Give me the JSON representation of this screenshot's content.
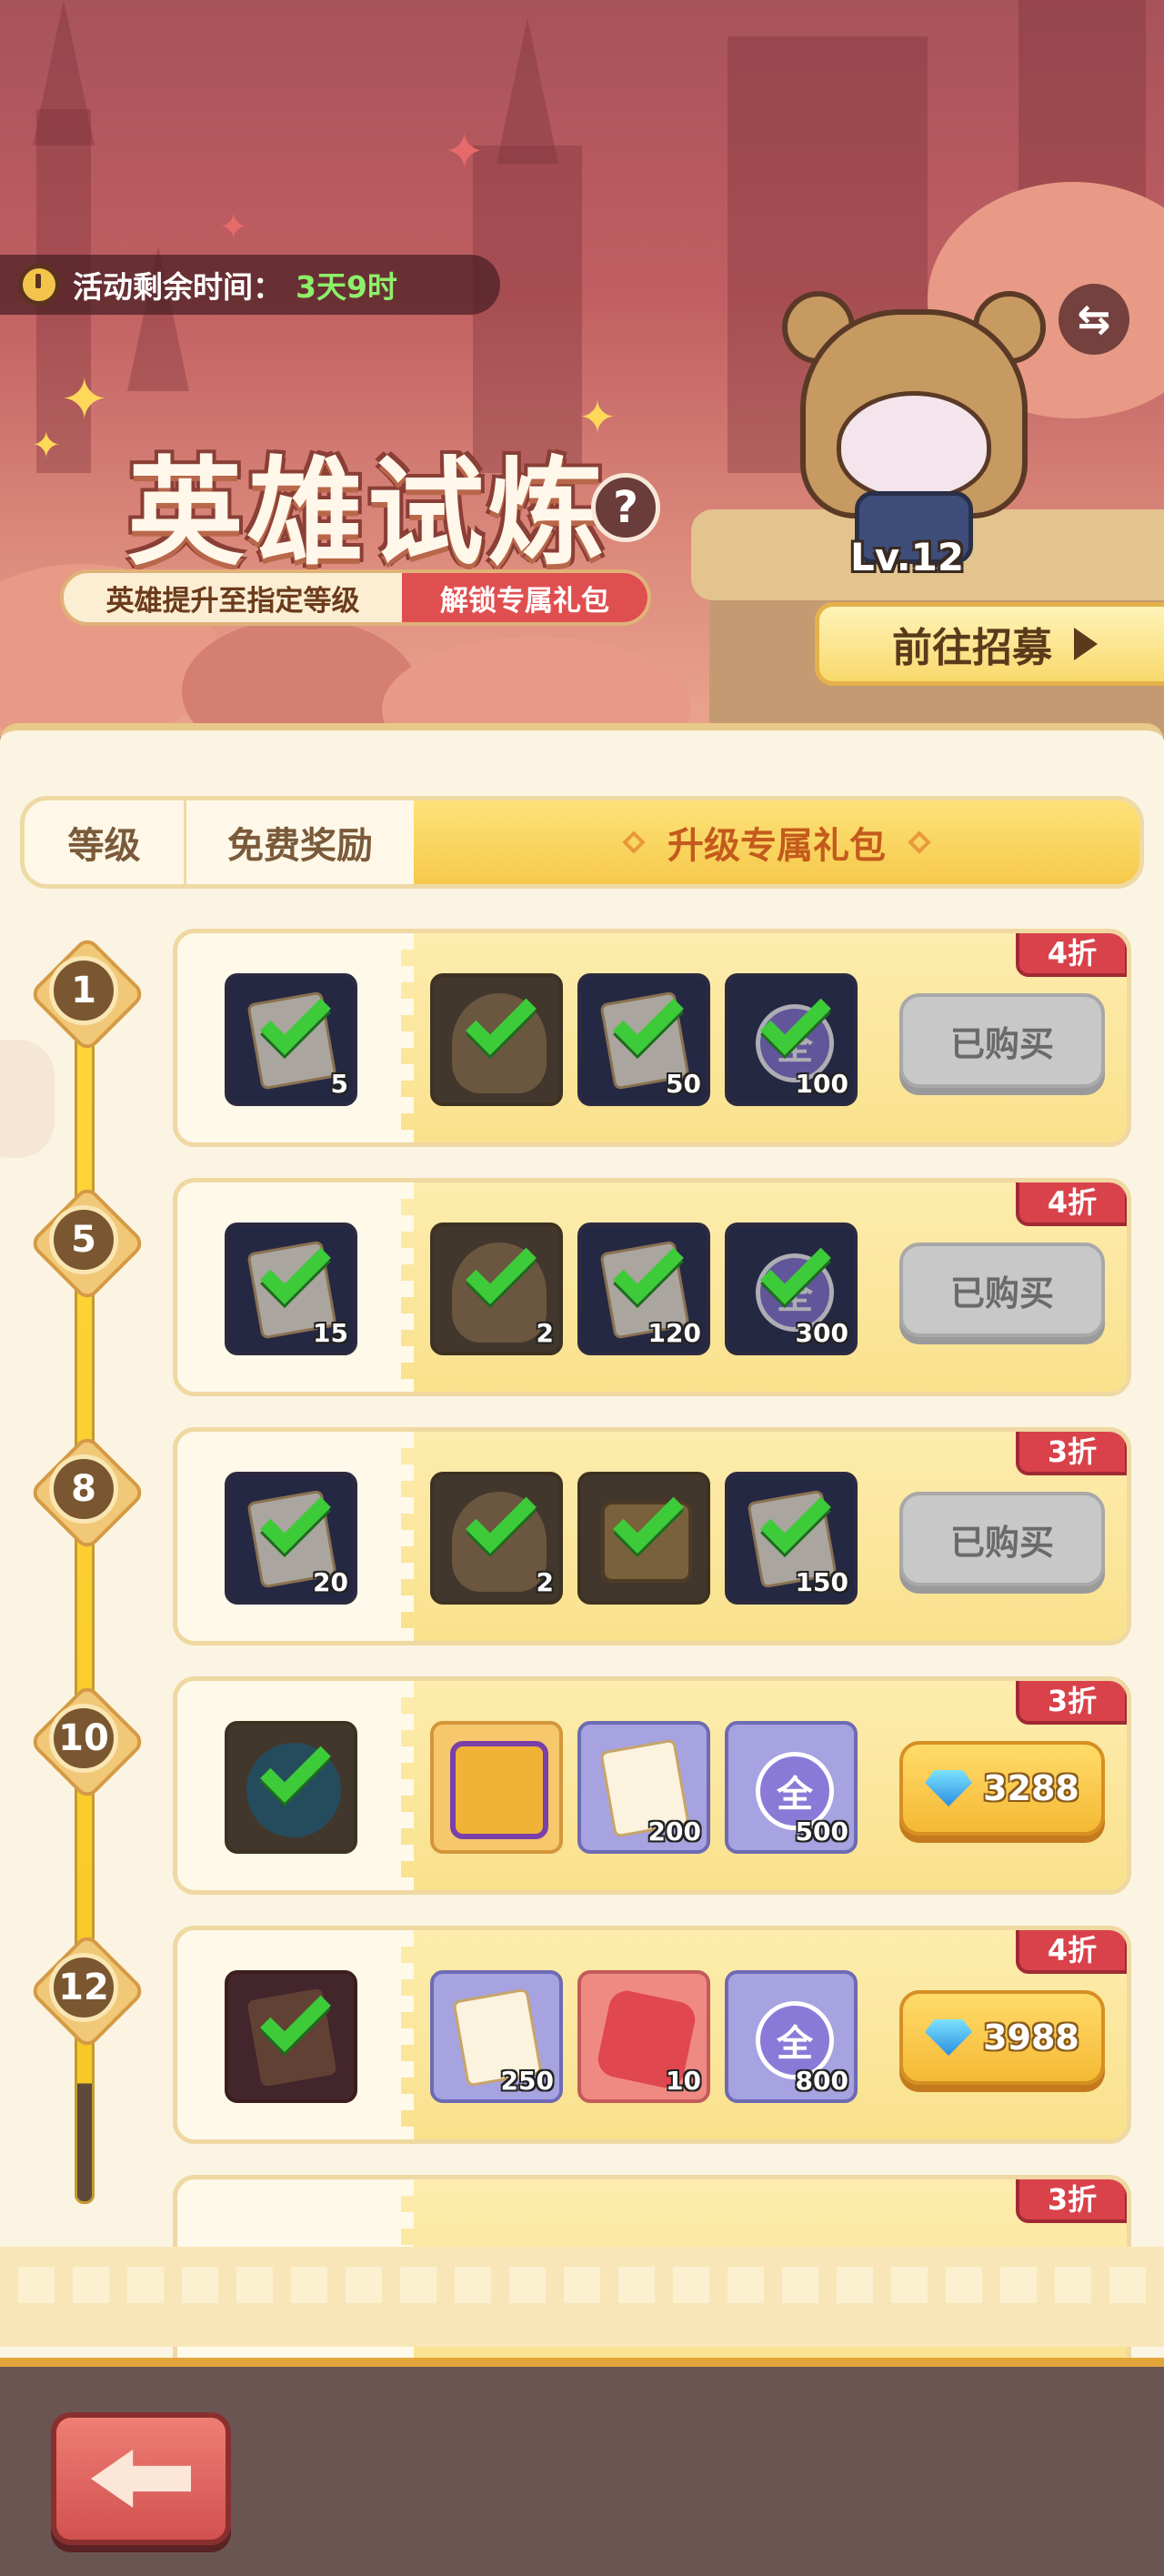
{
  "header": {
    "timer_label": "活动剩余时间：",
    "timer_value": "3天9时",
    "title": "英雄试炼",
    "subtitle_left": "英雄提升至指定等级",
    "subtitle_right": "解锁专属礼包",
    "hero_level": "Lv.12",
    "recruit_label": "前往招募"
  },
  "tabs": {
    "level": "等级",
    "free": "免费奖励",
    "exclusive": "升级专属礼包"
  },
  "rows": [
    {
      "level": "1",
      "discount": "4折",
      "button": "已购买",
      "free_qty": "5",
      "items": [
        "",
        "50",
        "100"
      ]
    },
    {
      "level": "5",
      "discount": "4折",
      "button": "已购买",
      "free_qty": "15",
      "items": [
        "2",
        "120",
        "300"
      ]
    },
    {
      "level": "8",
      "discount": "3折",
      "button": "已购买",
      "free_qty": "20",
      "items": [
        "2",
        "",
        "150"
      ]
    },
    {
      "level": "10",
      "discount": "3折",
      "button": "3288",
      "free_qty": "",
      "items": [
        "",
        "200",
        "500"
      ]
    },
    {
      "level": "12",
      "discount": "4折",
      "button": "3988",
      "free_qty": "",
      "items": [
        "250",
        "10",
        "800"
      ]
    },
    {
      "level": "",
      "discount": "3折",
      "button": "",
      "free_qty": "",
      "items": [
        "",
        "",
        ""
      ]
    }
  ],
  "orb_glyph": "全",
  "colors": {
    "accent_gold": "#f6c94a",
    "discount_red": "#d9424b",
    "check_green": "#3dcb3a",
    "timer_green": "#8ef06a"
  }
}
